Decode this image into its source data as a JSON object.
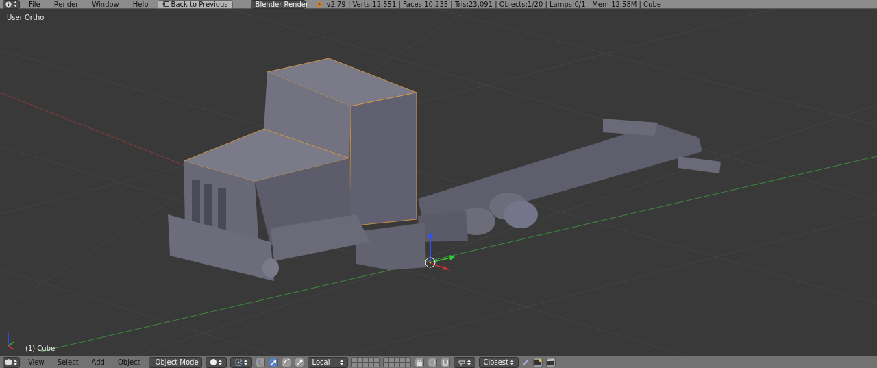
{
  "top_bar": {
    "menus": [
      "File",
      "Render",
      "Window",
      "Help"
    ],
    "back_button": "Back to Previous",
    "render_engine": "Blender Render",
    "stats": "v2.79 | Verts:12,551 | Faces:10,235 | Tris:23,091 | Objects:1/20 | Lamps:0/1 | Mem:12.58M | Cube"
  },
  "viewport": {
    "view_label": "User Ortho",
    "object_label": "(1) Cube"
  },
  "bottom_bar": {
    "menus": [
      "View",
      "Select",
      "Add",
      "Object"
    ],
    "mode": "Object Mode",
    "manipulators": [
      {
        "kind": "axes",
        "selected": false
      },
      {
        "kind": "translate",
        "selected": true
      },
      {
        "kind": "rotate",
        "selected": false
      },
      {
        "kind": "scale",
        "selected": false
      }
    ],
    "orientation": "Local",
    "snap_target": "Closest"
  }
}
